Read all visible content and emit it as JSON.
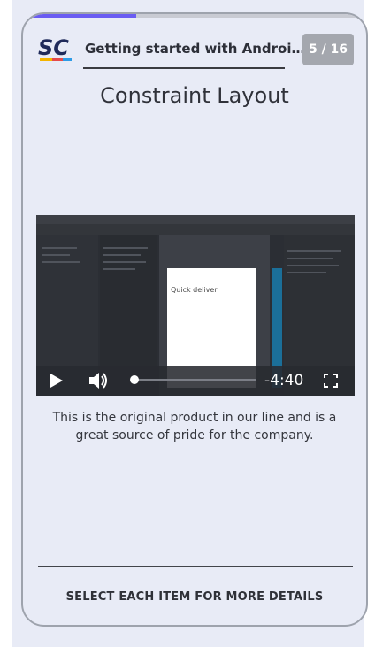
{
  "progress": {
    "fraction": 0.33,
    "fill_color": "#6a5cf2"
  },
  "header": {
    "logo_text": "SC",
    "title": "Getting started with Androi...",
    "page_indicator": "5 / 16"
  },
  "page_title": "Constraint Layout",
  "video": {
    "time_remaining": "-4:40",
    "progress_fraction": 0.02,
    "phone_preview_text": "Quick deliver"
  },
  "description": "This is the original product in our line and is a great source of pride for the company.",
  "footer": {
    "instruction": "SELECT EACH ITEM FOR MORE DETAILS"
  },
  "colors": {
    "background": "#e8ebf6",
    "badge": "#a4a7ae",
    "accent": "#6a5cf2"
  }
}
